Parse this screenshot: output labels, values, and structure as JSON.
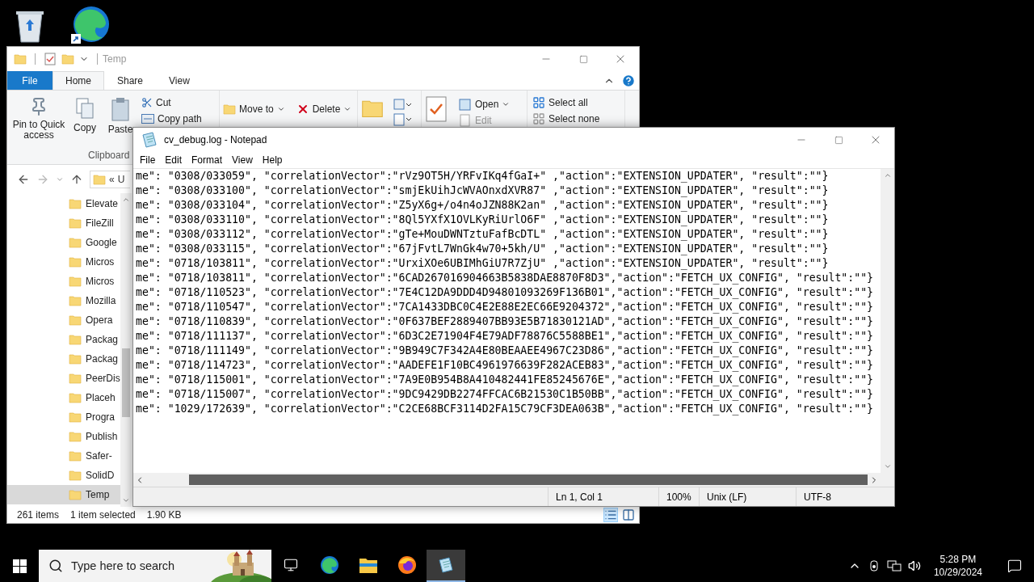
{
  "explorer": {
    "title": "Temp",
    "file_tab": "File",
    "tabs": [
      {
        "label": "Home",
        "selected": true
      },
      {
        "label": "Share",
        "selected": false
      },
      {
        "label": "View",
        "selected": false
      }
    ],
    "ribbon": {
      "clipboard": {
        "pin": "Pin to Quick access",
        "copy": "Copy",
        "paste": "Paste",
        "cut": "Cut",
        "copy_path": "Copy path",
        "label": "Clipboard"
      },
      "organize": {
        "move_to": "Move to",
        "delete": "Delete"
      },
      "open": {
        "open": "Open",
        "edit": {
          "label": "Edit",
          "disabled": true
        }
      },
      "select": {
        "select_all": "Select all",
        "select_none": "Select none"
      }
    },
    "address": {
      "overflow": "«",
      "crumb": "U"
    },
    "nav_items": [
      {
        "label": "Elevate",
        "selected": false
      },
      {
        "label": "FileZill",
        "selected": false
      },
      {
        "label": "Google",
        "selected": false
      },
      {
        "label": "Micros",
        "selected": false
      },
      {
        "label": "Micros",
        "selected": false
      },
      {
        "label": "Mozilla",
        "selected": false
      },
      {
        "label": "Opera",
        "selected": false
      },
      {
        "label": "Packag",
        "selected": false
      },
      {
        "label": "Packag",
        "selected": false
      },
      {
        "label": "PeerDis",
        "selected": false
      },
      {
        "label": "Placeh",
        "selected": false
      },
      {
        "label": "Progra",
        "selected": false
      },
      {
        "label": "Publish",
        "selected": false
      },
      {
        "label": "Safer-",
        "selected": false
      },
      {
        "label": "SolidD",
        "selected": false
      },
      {
        "label": "Temp",
        "selected": true
      }
    ],
    "status": {
      "items": "261 items",
      "selection": "1 item selected",
      "size": "1.90 KB"
    }
  },
  "notepad": {
    "title": "cv_debug.log - Notepad",
    "menu": [
      "File",
      "Edit",
      "Format",
      "View",
      "Help"
    ],
    "lines": [
      "me\": \"0308/033059\", \"correlationVector\":\"rVz9OT5H/YRFvIKq4fGaI+\" ,\"action\":\"EXTENSION_UPDATER\", \"result\":\"\"}",
      "me\": \"0308/033100\", \"correlationVector\":\"smjEkUihJcWVAOnxdXVR87\" ,\"action\":\"EXTENSION_UPDATER\", \"result\":\"\"}",
      "me\": \"0308/033104\", \"correlationVector\":\"Z5yX6g+/o4n4oJZN88K2an\" ,\"action\":\"EXTENSION_UPDATER\", \"result\":\"\"}",
      "me\": \"0308/033110\", \"correlationVector\":\"8Ql5YXfX1OVLKyRiUrlO6F\" ,\"action\":\"EXTENSION_UPDATER\", \"result\":\"\"}",
      "me\": \"0308/033112\", \"correlationVector\":\"gTe+MouDWNTztuFafBcDTL\" ,\"action\":\"EXTENSION_UPDATER\", \"result\":\"\"}",
      "me\": \"0308/033115\", \"correlationVector\":\"67jFvtL7WnGk4w70+5kh/U\" ,\"action\":\"EXTENSION_UPDATER\", \"result\":\"\"}",
      "me\": \"0718/103811\", \"correlationVector\":\"UrxiXOe6UBIMhGiU7R7ZjU\" ,\"action\":\"EXTENSION_UPDATER\", \"result\":\"\"}",
      "me\": \"0718/103811\", \"correlationVector\":\"6CAD267016904663B5838DAE8870F8D3\",\"action\":\"FETCH_UX_CONFIG\", \"result\":\"\"}",
      "me\": \"0718/110523\", \"correlationVector\":\"7E4C12DA9DDD4D94801093269F136B01\",\"action\":\"FETCH_UX_CONFIG\", \"result\":\"\"}",
      "me\": \"0718/110547\", \"correlationVector\":\"7CA1433DBC0C4E2E88E2EC66E9204372\",\"action\":\"FETCH_UX_CONFIG\", \"result\":\"\"}",
      "me\": \"0718/110839\", \"correlationVector\":\"0F637BEF2889407BB93E5B71830121AD\",\"action\":\"FETCH_UX_CONFIG\", \"result\":\"\"}",
      "me\": \"0718/111137\", \"correlationVector\":\"6D3C2E71904F4E79ADF78876C5588BE1\",\"action\":\"FETCH_UX_CONFIG\", \"result\":\"\"}",
      "me\": \"0718/111149\", \"correlationVector\":\"9B949C7F342A4E80BEAAEE4967C23D86\",\"action\":\"FETCH_UX_CONFIG\", \"result\":\"\"}",
      "me\": \"0718/114723\", \"correlationVector\":\"AADEFE1F10BC4961976639F282ACEB83\",\"action\":\"FETCH_UX_CONFIG\", \"result\":\"\"}",
      "me\": \"0718/115001\", \"correlationVector\":\"7A9E0B954B8A410482441FE85245676E\",\"action\":\"FETCH_UX_CONFIG\", \"result\":\"\"}",
      "me\": \"0718/115007\", \"correlationVector\":\"9DC9429DB2274FFCAC6B21530C1B50BB\",\"action\":\"FETCH_UX_CONFIG\", \"result\":\"\"}",
      "me\": \"1029/172639\", \"correlationVector\":\"C2CE68BCF3114D2FA15C79CF3DEA063B\",\"action\":\"FETCH_UX_CONFIG\", \"result\":\"\"}"
    ],
    "status": [
      "Ln 1, Col 1",
      "100%",
      "Unix (LF)",
      "UTF-8"
    ]
  },
  "taskbar": {
    "search_placeholder": "Type here to search",
    "apps": [
      {
        "kind": "edge",
        "selected": false
      },
      {
        "kind": "explorer",
        "selected": false
      },
      {
        "kind": "firefox",
        "selected": false
      },
      {
        "kind": "notepad",
        "selected": true
      }
    ],
    "time": "5:28 PM",
    "date": "10/29/2024"
  }
}
